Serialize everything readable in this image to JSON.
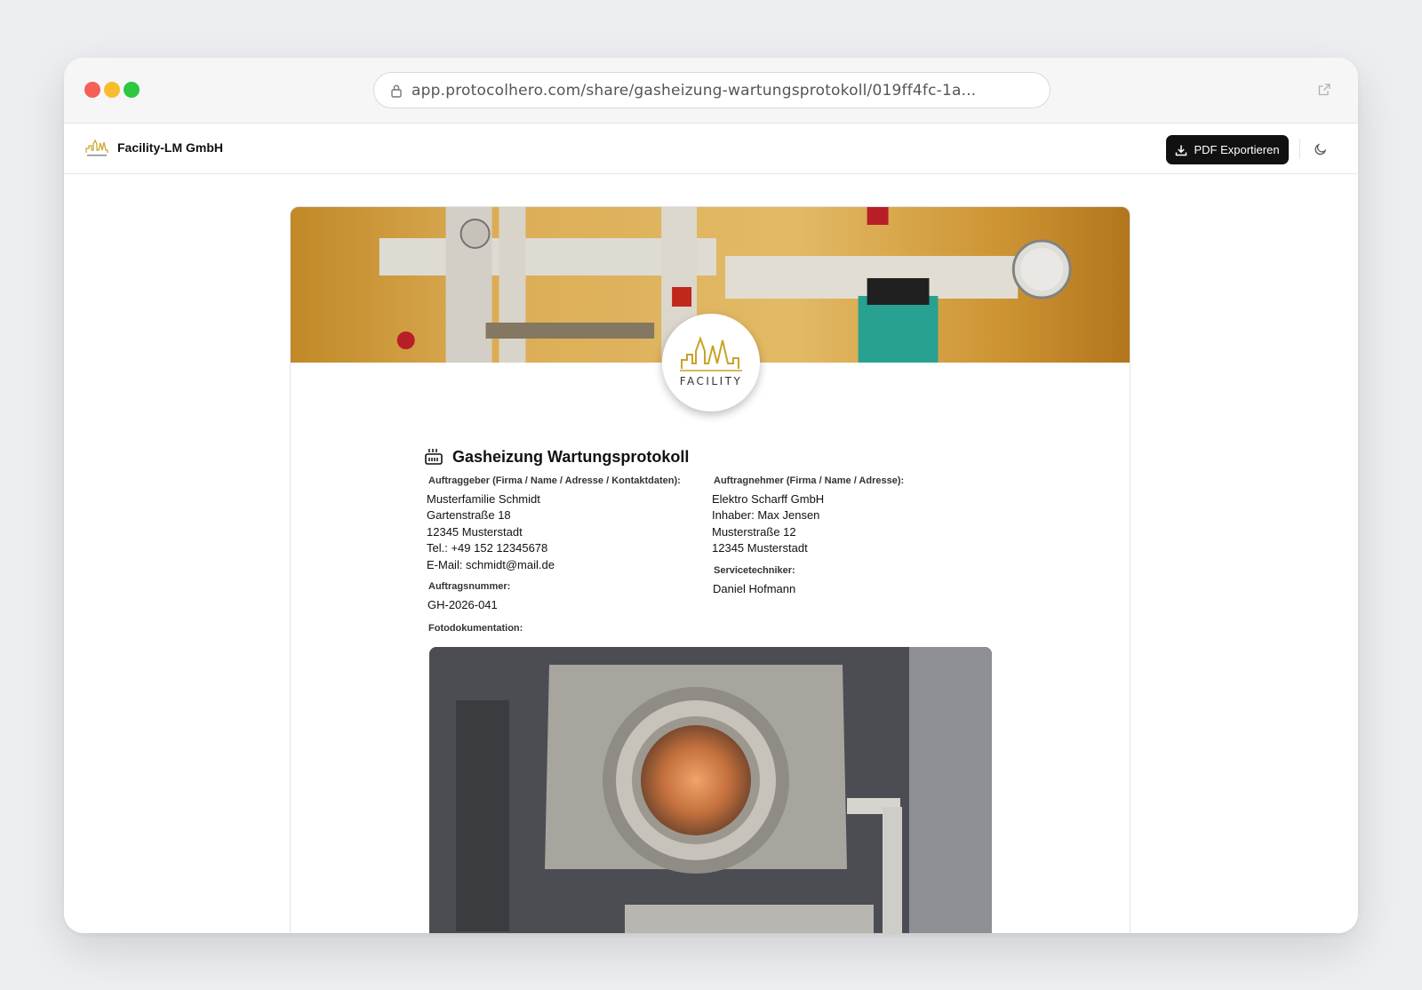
{
  "browser": {
    "url": "app.protocolhero.com/share/gasheizung-wartungsprotokoll/019ff4fc-1a..."
  },
  "appbar": {
    "company_name": "Facility-LM GmbH",
    "pdf_button_label": "PDF Exportieren"
  },
  "logo": {
    "wordmark": "FACILITY"
  },
  "protocol": {
    "title": "Gasheizung Wartungsprotokoll",
    "client": {
      "label": "Auftraggeber (Firma / Name / Adresse / Kontaktdaten):",
      "lines": [
        "Musterfamilie Schmidt",
        "Gartenstraße 18",
        "12345 Musterstadt",
        "Tel.: +49 152 12345678",
        "E-Mail: schmidt@mail.de"
      ]
    },
    "contractor": {
      "label": "Auftragnehmer (Firma / Name / Adresse):",
      "lines": [
        "Elektro Scharff GmbH",
        "Inhaber: Max Jensen",
        "Musterstraße 12",
        "12345 Musterstadt"
      ]
    },
    "order_number": {
      "label": "Auftragsnummer:",
      "value": "GH-2026-041"
    },
    "technician": {
      "label": "Servicetechniker:",
      "value": "Daniel Hofmann"
    },
    "photos": {
      "label": "Fotodokumentation:"
    }
  },
  "colors": {
    "accent": "#111111",
    "logo_gold": "#c9a227"
  }
}
